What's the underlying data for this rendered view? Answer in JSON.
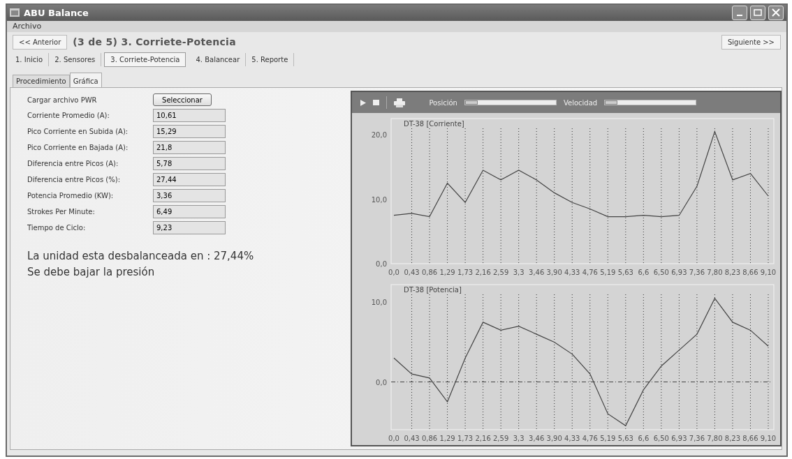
{
  "window": {
    "title": "ABU Balance"
  },
  "menu": [
    "Archivo"
  ],
  "nav": {
    "prev": "<< Anterior",
    "title": "(3 de 5) 3. Corriete-Potencia",
    "next": "Siguiente >>"
  },
  "steps": [
    {
      "label": "1. Inicio",
      "selected": false
    },
    {
      "label": "2. Sensores",
      "selected": false
    },
    {
      "label": "3. Corriete-Potencia",
      "selected": true
    },
    {
      "label": "4. Balancear",
      "selected": false
    },
    {
      "label": "5. Reporte",
      "selected": false
    }
  ],
  "subtabs": [
    {
      "label": "Procedimiento",
      "selected": false
    },
    {
      "label": "Gráfica",
      "selected": true
    }
  ],
  "form": {
    "load_label": "Cargar archivo PWR",
    "load_button": "Seleccionar",
    "fields": [
      {
        "label": "Corriente Promedio (A):",
        "value": "10,61"
      },
      {
        "label": "Pico Corriente en Subida (A):",
        "value": "15,29"
      },
      {
        "label": "Pico Corriente en Bajada (A):",
        "value": "21,8"
      },
      {
        "label": "Diferencia entre Picos (A):",
        "value": "5,78"
      },
      {
        "label": "Diferencia entre Picos (%):",
        "value": "27,44"
      },
      {
        "label": "Potencia Promedio (KW):",
        "value": "3,36"
      },
      {
        "label": "Strokes Per Minute:",
        "value": "6,49"
      },
      {
        "label": "Tiempo de Ciclo:",
        "value": "9,23"
      }
    ]
  },
  "messages": [
    "La unidad esta desbalanceada en : 27,44%",
    "Se debe bajar la presión"
  ],
  "chart_toolbar": {
    "sliders": [
      {
        "label": "Posición"
      },
      {
        "label": "Velocidad"
      }
    ]
  },
  "charts": [
    {
      "chart_data": {
        "type": "line",
        "grid": true,
        "title": "DT-38 [Corriente]",
        "categories": [
          "0,0",
          "0,43",
          "0,86",
          "1,29",
          "1,73",
          "2,16",
          "2,59",
          "3,3",
          "3,46",
          "3,90",
          "4,33",
          "4,76",
          "5,19",
          "5,63",
          "6,6",
          "6,50",
          "6,93",
          "7,36",
          "7,80",
          "8,23",
          "8,66",
          "9,10"
        ],
        "ylim": [
          0,
          21
        ],
        "yticks": [
          {
            "value": 0,
            "label": "0,0"
          },
          {
            "value": 10,
            "label": "10,0"
          },
          {
            "value": 20,
            "label": "20,0"
          }
        ],
        "series": [
          {
            "color": "#444444",
            "values": [
              7.5,
              7.8,
              7.3,
              12.5,
              9.5,
              14.5,
              13,
              14.5,
              13,
              11,
              9.5,
              8.5,
              7.3,
              7.3,
              7.5,
              7.3,
              7.5,
              12,
              20.5,
              13,
              14,
              10.5
            ]
          }
        ]
      }
    },
    {
      "chart_data": {
        "type": "line",
        "grid": true,
        "title": "DT-38 [Potencia]",
        "categories": [
          "0,0",
          "0,43",
          "0,86",
          "1,29",
          "1,73",
          "2,16",
          "2,59",
          "3,3",
          "3,46",
          "3,90",
          "4,33",
          "4,76",
          "5,19",
          "5,63",
          "6,6",
          "6,50",
          "6,93",
          "7,36",
          "7,80",
          "8,23",
          "8,66",
          "9,10"
        ],
        "ylim": [
          -6,
          11
        ],
        "ref_lines": [
          {
            "axis": "y",
            "value": 0
          }
        ],
        "yticks": [
          {
            "value": 0,
            "label": "0,0"
          },
          {
            "value": 10,
            "label": "10,0"
          }
        ],
        "series": [
          {
            "color": "#444444",
            "values": [
              3,
              1,
              0.5,
              -2.5,
              3,
              7.5,
              6.5,
              7,
              6,
              5,
              3.5,
              1,
              -4,
              -5.5,
              -1,
              2,
              4,
              6,
              10.5,
              7.5,
              6.5,
              4.5
            ]
          }
        ]
      }
    }
  ]
}
